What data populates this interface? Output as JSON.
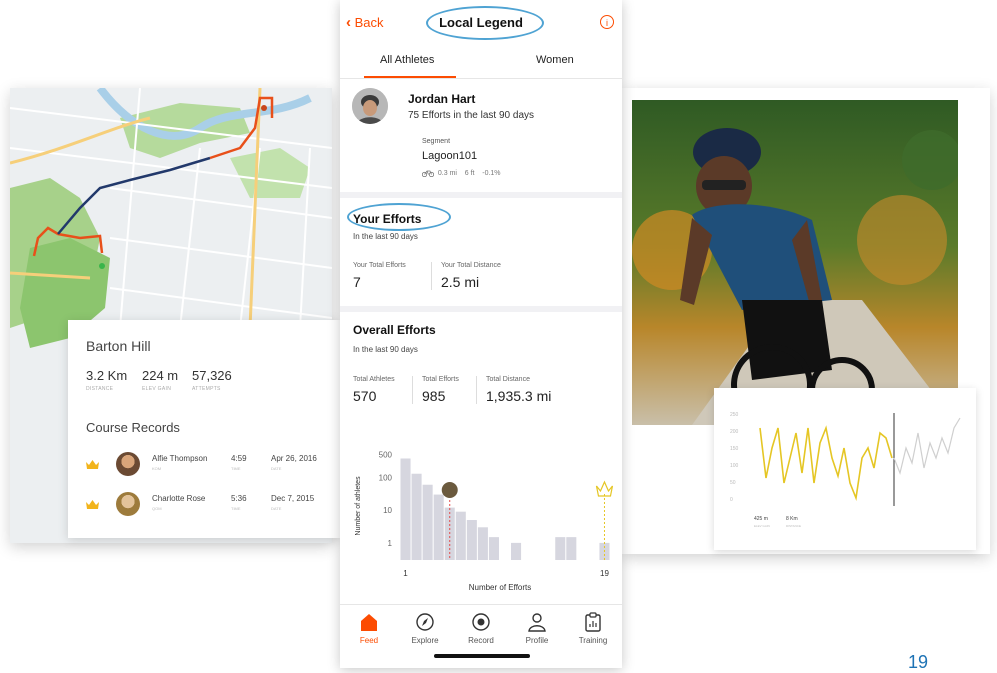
{
  "map_card": {
    "segment_name": "Barton Hill",
    "stats": [
      {
        "value": "3.2 Km",
        "label": "DISTANCE"
      },
      {
        "value": "224 m",
        "label": "ELEV GAIN"
      },
      {
        "value": "57,326",
        "label": "ATTEMPTS"
      }
    ],
    "course_records_title": "Course Records",
    "records": [
      {
        "name": "Alfie Thompson",
        "badge": "KOM",
        "time": "4:59",
        "time_label": "TIME",
        "date": "Apr 26, 2016",
        "date_label": "DATE"
      },
      {
        "name": "Charlotte Rose",
        "badge": "QOM",
        "time": "5:36",
        "time_label": "TIME",
        "date": "Dec 7, 2015",
        "date_label": "DATE"
      }
    ]
  },
  "phone": {
    "back_label": "Back",
    "title": "Local Legend",
    "info_icon": "info-icon",
    "tabs": [
      "All Athletes",
      "Women"
    ],
    "active_tab": "All Athletes",
    "athlete": {
      "name": "Jordan Hart",
      "efforts_text": "75 Efforts in the last 90 days",
      "segment_label": "Segment",
      "segment_name": "Lagoon101",
      "segment_distance": "0.3 mi",
      "segment_elev": "6 ft",
      "segment_grade": "-0.1%"
    },
    "your_efforts": {
      "title": "Your Efforts",
      "subtitle": "In the last 90 days",
      "metrics": [
        {
          "label": "Your Total Efforts",
          "value": "7"
        },
        {
          "label": "Your Total Distance",
          "value": "2.5 mi"
        }
      ]
    },
    "overall_efforts": {
      "title": "Overall Efforts",
      "subtitle": "In the last 90 days",
      "metrics": [
        {
          "label": "Total Athletes",
          "value": "570"
        },
        {
          "label": "Total Efforts",
          "value": "985"
        },
        {
          "label": "Total Distance",
          "value": "1,935.3 mi"
        }
      ]
    },
    "tab_bar": [
      {
        "label": "Feed",
        "icon": "home-icon",
        "active": true
      },
      {
        "label": "Explore",
        "icon": "compass-icon",
        "active": false
      },
      {
        "label": "Record",
        "icon": "record-icon",
        "active": false
      },
      {
        "label": "Profile",
        "icon": "person-icon",
        "active": false
      },
      {
        "label": "Training",
        "icon": "clipboard-icon",
        "active": false
      }
    ],
    "accent_color": "#fc4c02"
  },
  "elevation_card": {
    "y_ticks": [
      "250",
      "200",
      "150",
      "100",
      "50",
      "0"
    ],
    "stats": [
      {
        "value": "425 m",
        "label": "ELEV GAIN"
      },
      {
        "value": "8 Km",
        "label": "DISTANCE"
      }
    ]
  },
  "chart_data": {
    "type": "bar",
    "ylabel": "Number of athletes",
    "xlabel": "Number of Efforts",
    "yticks": [
      "500",
      "100",
      "10",
      "1"
    ],
    "xticks": [
      "1",
      "19"
    ],
    "x": [
      1,
      2,
      3,
      4,
      5,
      6,
      7,
      8,
      9,
      11,
      15,
      16,
      19
    ],
    "values": [
      380,
      130,
      60,
      30,
      12,
      9,
      5,
      3,
      1.5,
      1,
      1.5,
      1.5,
      1
    ],
    "markers": [
      {
        "x": 5,
        "label": "you"
      },
      {
        "x": 19,
        "label": "local legend"
      }
    ]
  },
  "page_number": "19"
}
